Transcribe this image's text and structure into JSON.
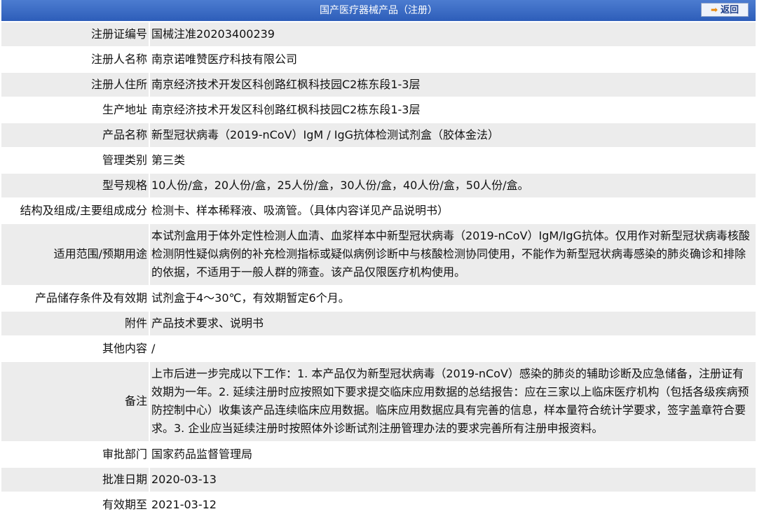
{
  "header": {
    "title": "国产医疗器械产品（注册）",
    "back_label": "返回"
  },
  "rows": [
    {
      "label": "注册证编号",
      "value": "国械注准20203400239"
    },
    {
      "label": "注册人名称",
      "value": "南京诺唯赞医疗科技有限公司"
    },
    {
      "label": "注册人住所",
      "value": "南京经济技术开发区科创路红枫科技园C2栋东段1-3层"
    },
    {
      "label": "生产地址",
      "value": "南京经济技术开发区科创路红枫科技园C2栋东段1-3层"
    },
    {
      "label": "产品名称",
      "value": "新型冠状病毒（2019-nCoV）IgM / IgG抗体检测试剂盒（胶体金法）"
    },
    {
      "label": "管理类别",
      "value": "第三类"
    },
    {
      "label": "型号规格",
      "value": "10人份/盒，20人份/盒，25人份/盒，30人份/盒，40人份/盒，50人份/盒。"
    },
    {
      "label": "结构及组成/主要组成成分",
      "value": "检测卡、样本稀释液、吸滴管。（具体内容详见产品说明书）"
    },
    {
      "label": "适用范围/预期用途",
      "value": "本试剂盒用于体外定性检测人血清、血浆样本中新型冠状病毒（2019-nCoV）IgM/IgG抗体。仅用作对新型冠状病毒核酸检测阴性疑似病例的补充检测指标或疑似病例诊断中与核酸检测协同使用，不能作为新型冠状病毒感染的肺炎确诊和排除的依据，不适用于一般人群的筛查。该产品仅限医疗机构使用。"
    },
    {
      "label": "产品储存条件及有效期",
      "value": "试剂盒于4～30℃，有效期暂定6个月。"
    },
    {
      "label": "附件",
      "value": "产品技术要求、说明书"
    },
    {
      "label": "其他内容",
      "value": "/"
    },
    {
      "label": "备注",
      "value": "上市后进一步完成以下工作：1. 本产品仅为新型冠状病毒（2019-nCoV）感染的肺炎的辅助诊断及应急储备，注册证有效期为一年。2. 延续注册时应按照如下要求提交临床应用数据的总结报告：应在三家以上临床医疗机构（包括各级疾病预防控制中心）收集该产品连续临床应用数据。临床应用数据应具有完善的信息，样本量符合统计学要求，签字盖章符合要求。3. 企业应当延续注册时按照体外诊断试剂注册管理办法的要求完善所有注册申报资料。"
    },
    {
      "label": "审批部门",
      "value": "国家药品监督管理局"
    },
    {
      "label": "批准日期",
      "value": "2020-03-13"
    },
    {
      "label": "有效期至",
      "value": "2021-03-12"
    }
  ],
  "colors": {
    "header_bg": "#2d5db9",
    "row_alt_bg": "#ececec"
  },
  "icons": {
    "back": "arrow-right-icon"
  }
}
